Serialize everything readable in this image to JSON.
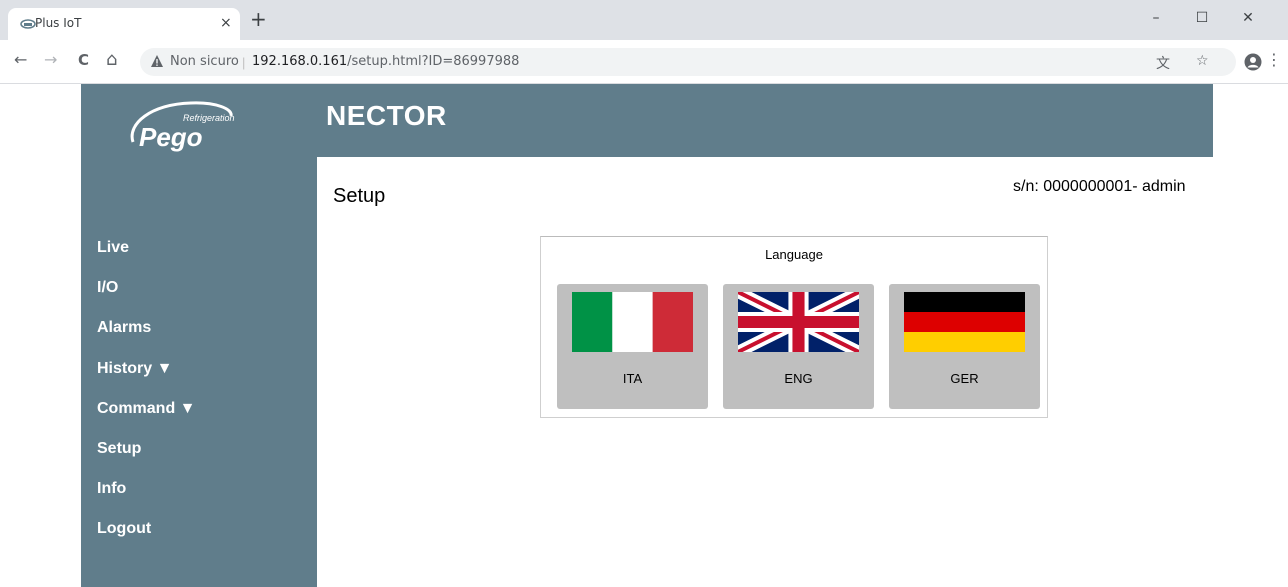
{
  "browser": {
    "tab_title": "Plus IoT",
    "tab_close": "×",
    "new_tab": "+",
    "insecure_label": "Non sicuro",
    "separator": "|",
    "url_host": "192.168.0.161",
    "url_path": "/setup.html?ID=86997988",
    "window_minimize": "–",
    "window_maximize": "☐",
    "window_close": "✕",
    "back": "←",
    "forward": "→",
    "reload": "C",
    "home": "⌂",
    "translate_icon": "文",
    "bookmark_icon": "☆",
    "menu_icon": "⋮"
  },
  "app": {
    "brand": "NECTOR",
    "logo_tagline": "Refrigeration",
    "logo_text": "Pego",
    "section_title": "Setup",
    "serial": "s/n: 0000000001- admin"
  },
  "nav": {
    "items": [
      {
        "label": "Live"
      },
      {
        "label": "I/O"
      },
      {
        "label": "Alarms"
      },
      {
        "label": "History ▼"
      },
      {
        "label": "Command ▼"
      },
      {
        "label": "Setup"
      },
      {
        "label": "Info"
      },
      {
        "label": "Logout"
      }
    ]
  },
  "language": {
    "title": "Language",
    "options": [
      {
        "label": "ITA",
        "icon": "italy-flag-icon"
      },
      {
        "label": "ENG",
        "icon": "uk-flag-icon"
      },
      {
        "label": "GER",
        "icon": "germany-flag-icon"
      }
    ]
  },
  "colors": {
    "sidebar": "#607d8b",
    "button_bg": "#bfbfbf"
  }
}
